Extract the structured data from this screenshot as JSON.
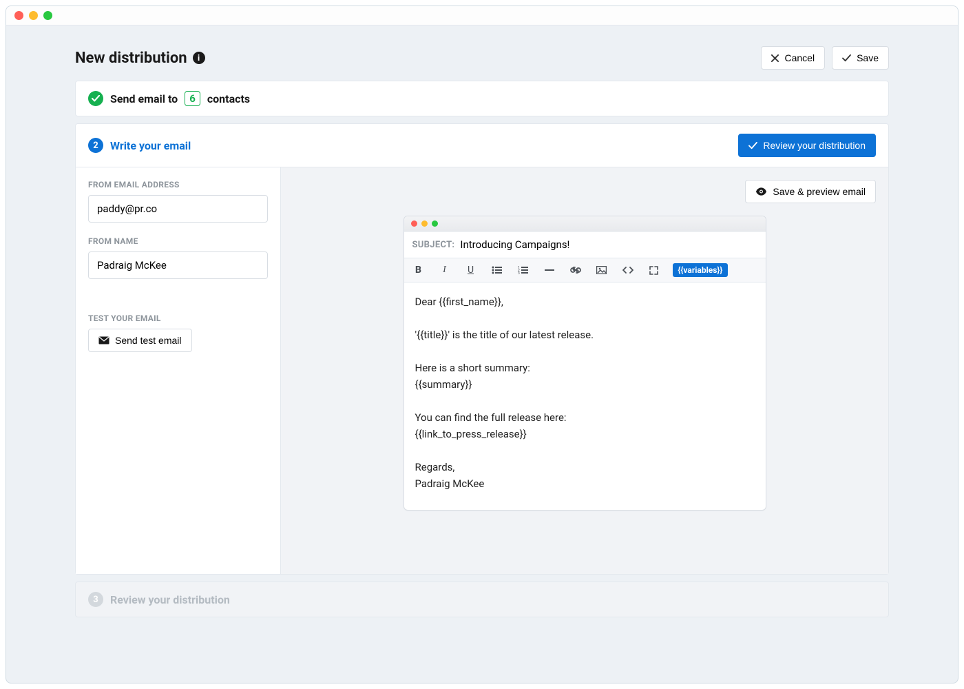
{
  "header": {
    "title": "New distribution",
    "cancel_label": "Cancel",
    "save_label": "Save"
  },
  "step1": {
    "prefix": "Send email to",
    "count": "6",
    "suffix": "contacts"
  },
  "step2": {
    "number": "2",
    "title": "Write your email",
    "review_button": "Review your distribution",
    "save_preview_button": "Save & preview email"
  },
  "sidebar": {
    "from_email_label": "FROM EMAIL ADDRESS",
    "from_email_value": "paddy@pr.co",
    "from_name_label": "FROM NAME",
    "from_name_value": "Padraig McKee",
    "test_label": "TEST YOUR EMAIL",
    "send_test_label": "Send test email"
  },
  "editor": {
    "subject_label": "SUBJECT:",
    "subject_value": "Introducing Campaigns!",
    "variables_label": "{{variables}}",
    "body": "Dear {{first_name}},\n\n'{{title}}' is the title of our latest release.\n\nHere is a short summary:\n{{summary}}\n\nYou can find the full release here:\n{{link_to_press_release}}\n\nRegards,\nPadraig McKee"
  },
  "step3": {
    "number": "3",
    "title": "Review your distribution"
  }
}
